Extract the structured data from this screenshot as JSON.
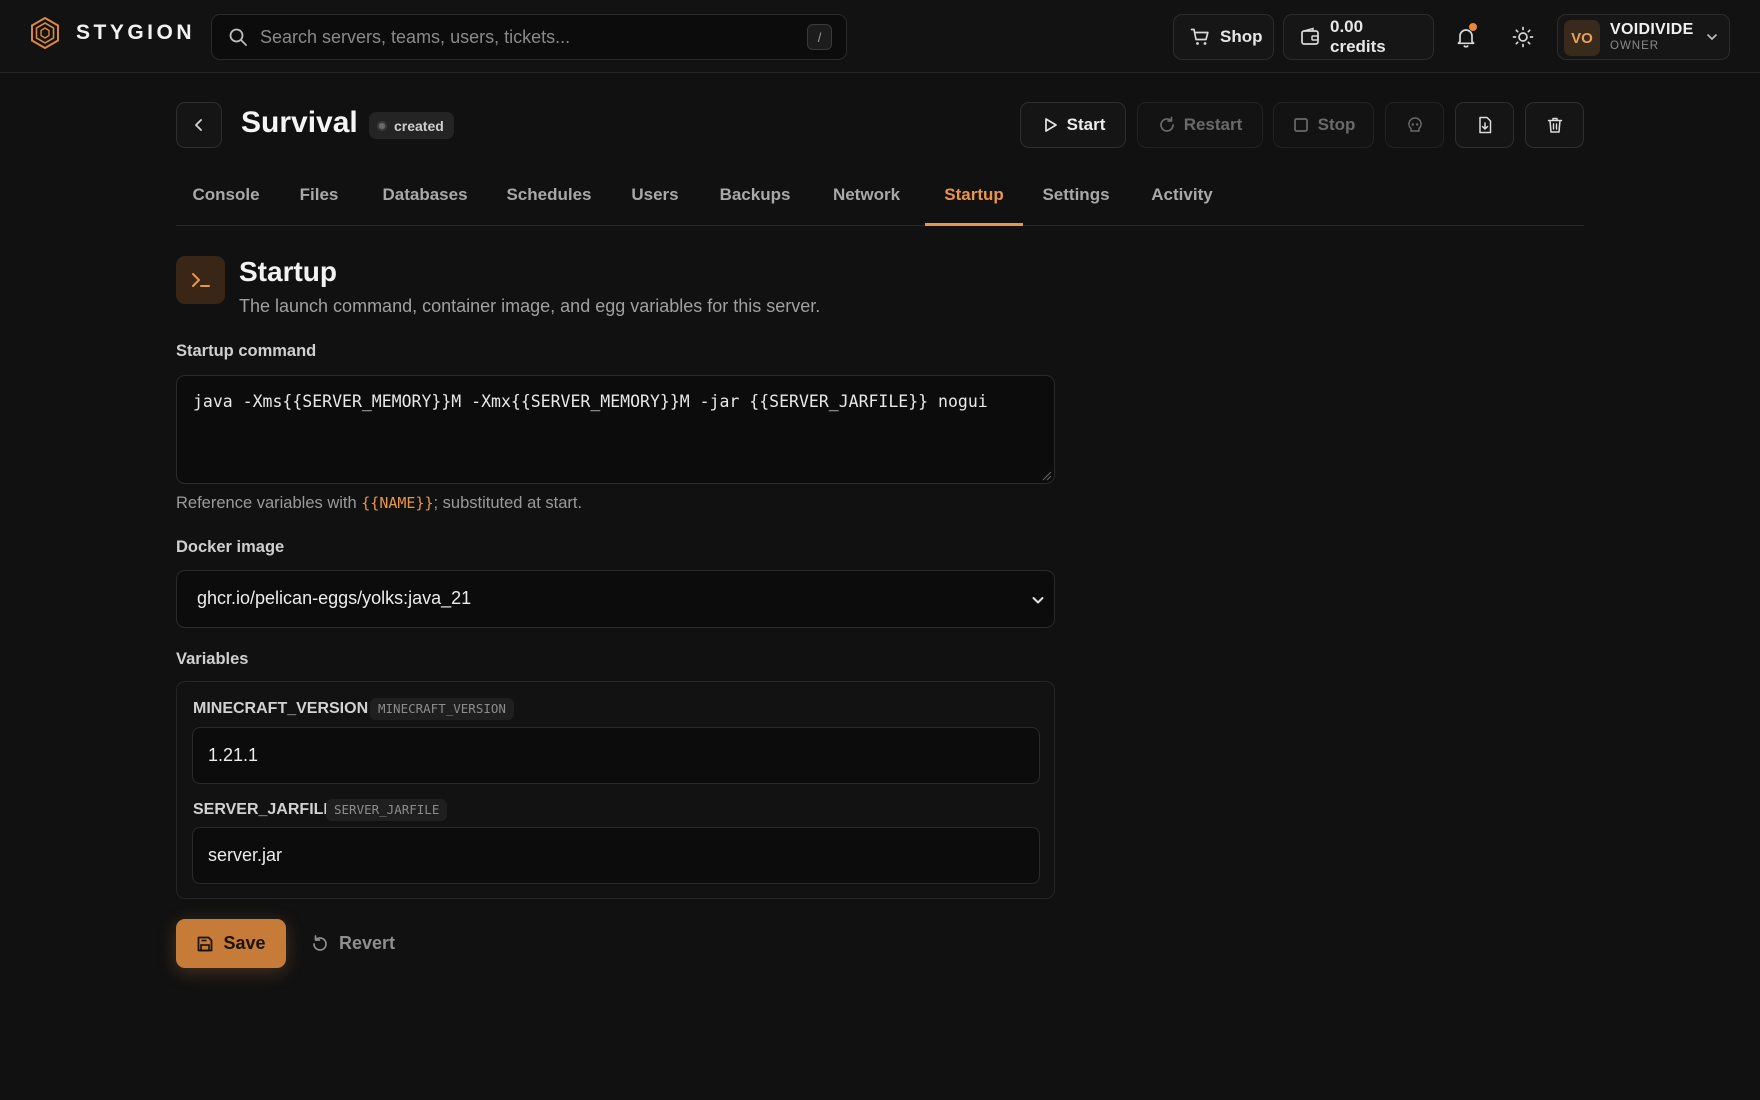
{
  "brand": {
    "name": "STYGION"
  },
  "search": {
    "placeholder": "Search servers, teams, users, tickets...",
    "shortcut": "/"
  },
  "topbar": {
    "shop_label": "Shop",
    "credits_label": "0.00 credits",
    "user": {
      "initials": "VO",
      "name": "VOIDIVIDE",
      "role": "OWNER"
    }
  },
  "server": {
    "name": "Survival",
    "status": "created",
    "actions": {
      "start": "Start",
      "restart": "Restart",
      "stop": "Stop"
    }
  },
  "tabs": [
    {
      "label": "Console"
    },
    {
      "label": "Files"
    },
    {
      "label": "Databases"
    },
    {
      "label": "Schedules"
    },
    {
      "label": "Users"
    },
    {
      "label": "Backups"
    },
    {
      "label": "Network"
    },
    {
      "label": "Startup",
      "active": true
    },
    {
      "label": "Settings"
    },
    {
      "label": "Activity"
    }
  ],
  "startup": {
    "title": "Startup",
    "subtitle": "The launch command, container image, and egg variables for this server.",
    "command_label": "Startup command",
    "command": "java -Xms{{SERVER_MEMORY}}M -Xmx{{SERVER_MEMORY}}M -jar {{SERVER_JARFILE}} nogui",
    "hint_prefix": "Reference variables with ",
    "hint_code": "{{NAME}}",
    "hint_suffix": "; substituted at start.",
    "docker_label": "Docker image",
    "docker_image": "ghcr.io/pelican-eggs/yolks:java_21",
    "variables_label": "Variables",
    "variables": [
      {
        "name": "MINECRAFT_VERSION",
        "env": "MINECRAFT_VERSION",
        "value": "1.21.1"
      },
      {
        "name": "SERVER_JARFILE",
        "env": "SERVER_JARFILE",
        "value": "server.jar"
      }
    ],
    "save_label": "Save",
    "revert_label": "Revert"
  },
  "colors": {
    "accent": "#e9954a",
    "background": "#111111",
    "notification_dot": "#e8893a"
  }
}
